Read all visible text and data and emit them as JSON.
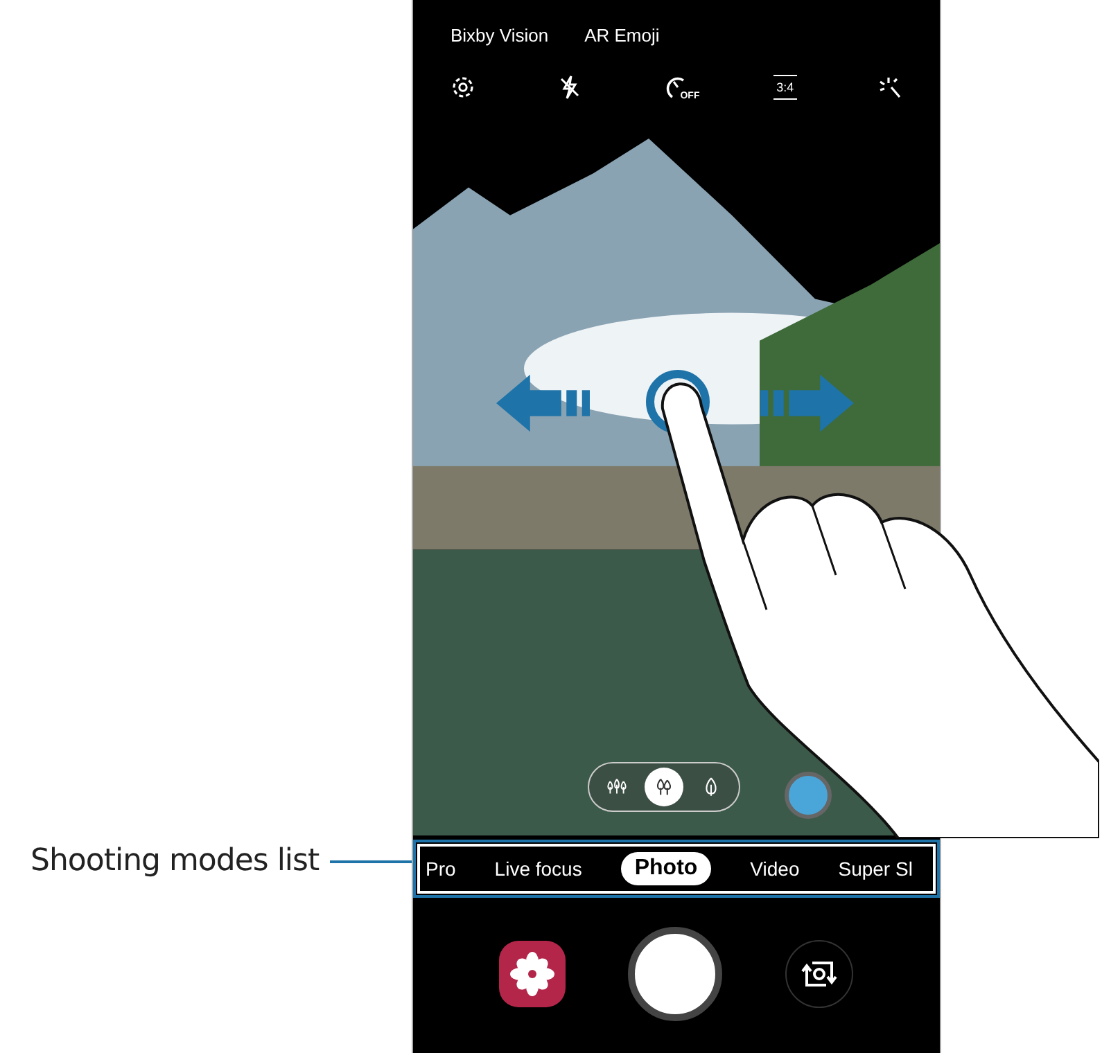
{
  "callout": {
    "label": "Shooting modes list"
  },
  "top_bar": {
    "links": [
      "Bixby Vision",
      "AR Emoji"
    ]
  },
  "quick_settings": [
    {
      "kind": "settings"
    },
    {
      "kind": "flash"
    },
    {
      "kind": "timer",
      "label": "OFF"
    },
    {
      "kind": "ratio",
      "label": "3:4"
    },
    {
      "kind": "effects"
    }
  ],
  "depth_options": [
    {
      "kind": "trees-wide",
      "selected": false
    },
    {
      "kind": "trees",
      "selected": true
    },
    {
      "kind": "leaf",
      "selected": false
    }
  ],
  "modes": [
    {
      "label": "Pro",
      "selected": false
    },
    {
      "label": "Live focus",
      "selected": false
    },
    {
      "label": "Photo",
      "selected": true
    },
    {
      "label": "Video",
      "selected": false
    },
    {
      "label": "Super Sl",
      "selected": false
    }
  ]
}
